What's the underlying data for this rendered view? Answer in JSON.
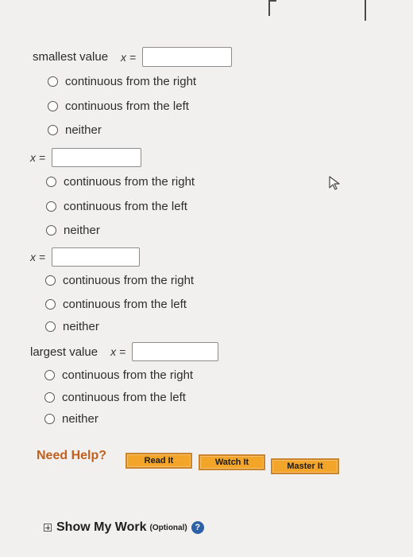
{
  "question": {
    "smallest_label": "smallest value",
    "largest_label": "largest value",
    "x_label": "x =",
    "options": [
      "continuous from the right",
      "continuous from the left",
      "neither"
    ]
  },
  "help": {
    "title": "Need Help?",
    "read_it": "Read It",
    "watch_it": "Watch It",
    "master_it": "Master It"
  },
  "show_work": {
    "label": "Show My Work",
    "optional": "(Optional)",
    "help_glyph": "?"
  },
  "icons": [
    "plus-box-icon",
    "help-circle-icon",
    "cursor-icon",
    "radio-icon"
  ],
  "colors": {
    "background": "#f1f0ee",
    "need_help": "#c1601e",
    "button_fill": "#f3a52a",
    "help_icon": "#2d5fa8"
  }
}
